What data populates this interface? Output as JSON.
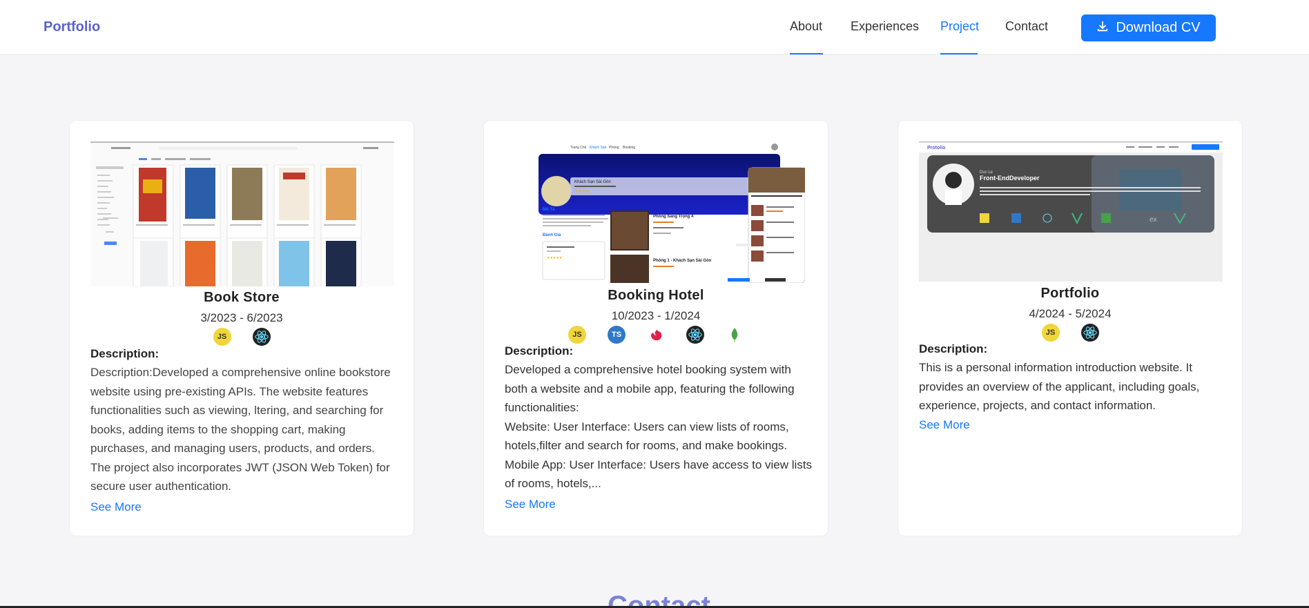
{
  "header": {
    "brand": "Portfolio",
    "nav": [
      {
        "label": "About",
        "active": false
      },
      {
        "label": "Experiences",
        "active": false
      },
      {
        "label": "Project",
        "active": true
      },
      {
        "label": "Contact",
        "active": false
      }
    ],
    "download_label": "Download CV",
    "download_icon": "download-icon"
  },
  "projects": [
    {
      "title": "Book Store",
      "date": "3/2023 - 6/2023",
      "tech": [
        "JS",
        "React"
      ],
      "desc_head": "Description:",
      "desc": "Description:Developed a comprehensive online bookstore website using pre-existing APIs. The website features functionalities such as viewing, ltering, and searching for books, adding items to the shopping cart, making purchases, and managing users, products, and orders. The project also incorporates JWT (JSON Web Token) for secure user authentication.",
      "see_more": "See More"
    },
    {
      "title": "Booking Hotel",
      "date": "10/2023 - 1/2024",
      "tech": [
        "JS",
        "TS",
        "NestJS",
        "React",
        "MongoDB"
      ],
      "desc_head": "Description:",
      "desc": "Developed a comprehensive hotel booking system with both a website and a mobile app, featuring the following functionalities:\nWebsite: User Interface: Users can view lists of rooms, hotels,filter and search for rooms, and make bookings.\nMobile App: User Interface: Users have access to view lists of rooms, hotels,...",
      "see_more": "See More"
    },
    {
      "title": "Portfolio",
      "date": "4/2024 - 5/2024",
      "tech": [
        "JS",
        "React"
      ],
      "desc_head": "Description:",
      "desc": "This is a personal information introduction website. It provides an overview of the applicant, including goals, experience, projects, and contact information.",
      "see_more": "See More"
    }
  ],
  "screenshots": {
    "hotel": {
      "nav": [
        "Trang Chủ",
        "Khách Sạn",
        "Phòng",
        "Booking"
      ],
      "hotel_name": "Khách Sạn Sài Gòn",
      "section_desc": "Mô Tả",
      "section_review": "Đánh Giá",
      "room_1": "Phòng Sang Trọng 4",
      "room_2": "Phòng 1 - Khách Sạn Sài Gòn"
    },
    "portfolio": {
      "brand": "Protolio",
      "name": "Duc Le",
      "role": "Front-EndDeveloper"
    }
  },
  "footer": {
    "contact_heading": "Contact"
  }
}
